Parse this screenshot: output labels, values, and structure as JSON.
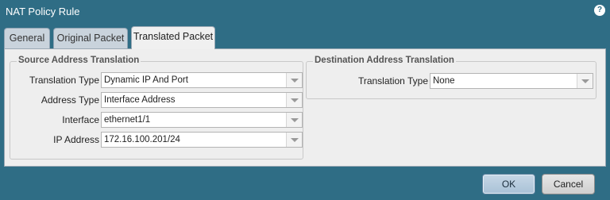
{
  "window": {
    "title": "NAT Policy Rule",
    "help_icon": "question-mark-icon",
    "help_glyph": "?"
  },
  "tabs": [
    {
      "label": "General",
      "active": false
    },
    {
      "label": "Original Packet",
      "active": false
    },
    {
      "label": "Translated Packet",
      "active": true
    }
  ],
  "source_translation": {
    "title": "Source Address Translation",
    "fields": [
      {
        "label": "Translation Type",
        "value": "Dynamic IP And Port"
      },
      {
        "label": "Address Type",
        "value": "Interface Address"
      },
      {
        "label": "Interface",
        "value": "ethernet1/1"
      },
      {
        "label": "IP Address",
        "value": "172.16.100.201/24"
      }
    ]
  },
  "destination_translation": {
    "title": "Destination Address Translation",
    "fields": [
      {
        "label": "Translation Type",
        "value": "None"
      }
    ]
  },
  "buttons": {
    "ok": "OK",
    "cancel": "Cancel"
  },
  "colors": {
    "dialog_background": "#2f6d85",
    "ok_button": "#a9c1d6"
  }
}
